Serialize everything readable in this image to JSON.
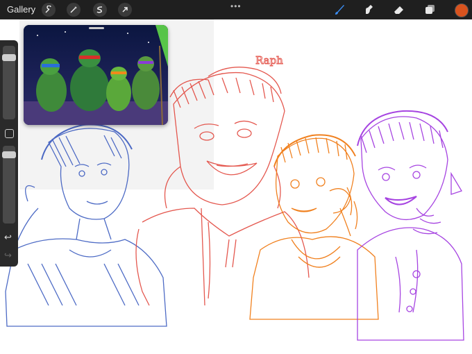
{
  "toolbar": {
    "gallery_label": "Gallery",
    "left_tools": [
      "wrench-icon",
      "magic-wand-icon",
      "selection-icon",
      "transform-arrow-icon"
    ],
    "right_tools": [
      "brush-icon",
      "smudge-icon",
      "eraser-icon",
      "layers-icon"
    ],
    "active_tool": "brush-icon",
    "current_color": "#d9531e"
  },
  "sidebar": {
    "brush_size_level": 0.9,
    "opacity_level": 0.95
  },
  "canvas": {
    "handwritten_label": "Raph",
    "sketch_colors": [
      "#3a5bbf",
      "#e2463c",
      "#f07a12",
      "#a23be0"
    ]
  }
}
